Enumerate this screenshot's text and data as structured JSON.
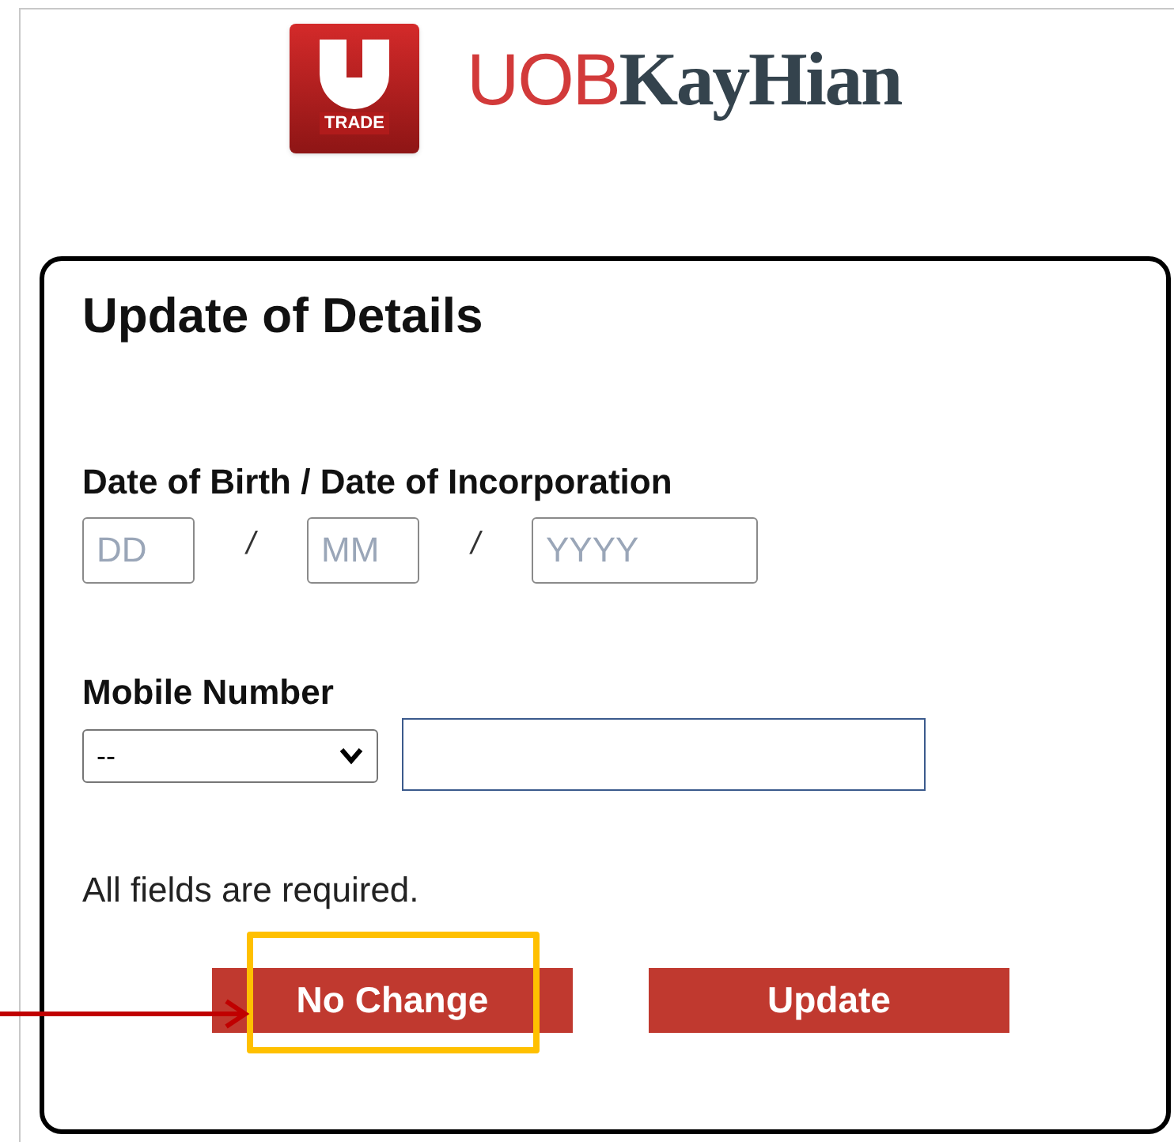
{
  "logo": {
    "badge_text": "TRADE",
    "brand_prefix": "UOB",
    "brand_name": "KayHian"
  },
  "form": {
    "title": "Update of Details",
    "date_of_birth": {
      "label": "Date of Birth / Date of Incorporation",
      "fields": [
        {
          "placeholder": "DD"
        },
        {
          "placeholder": "MM"
        },
        {
          "placeholder": "YYYY"
        }
      ],
      "separators": [
        "/",
        "/"
      ]
    },
    "mobile_number": {
      "label": "Mobile Number",
      "country_code": {
        "value": "--"
      }
    },
    "note": "All fields are required.",
    "buttons": [
      {
        "label": "No Change",
        "highlighted": true
      },
      {
        "label": "Update",
        "highlighted": false
      }
    ]
  }
}
